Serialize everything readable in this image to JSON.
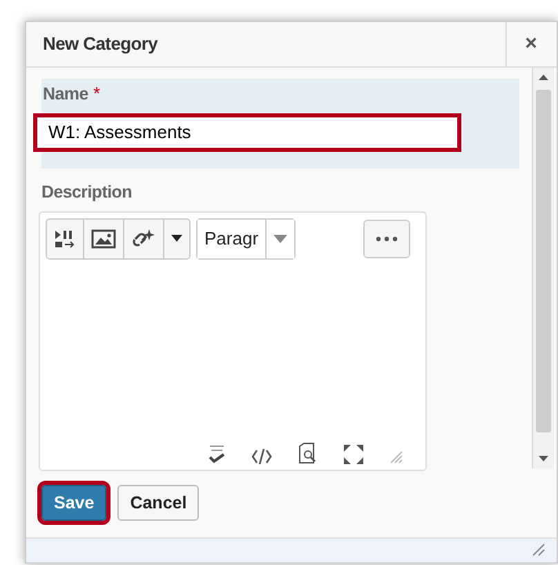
{
  "dialog": {
    "title": "New Category",
    "close": "×"
  },
  "name_field": {
    "label": "Name",
    "required_mark": "*",
    "value": "W1: Assessments",
    "highlighted": true
  },
  "description": {
    "label": "Description",
    "format_select": "Paragr"
  },
  "buttons": [
    {
      "label": "Save",
      "kind": "primary",
      "highlighted": true
    },
    {
      "label": "Cancel",
      "kind": "secondary",
      "highlighted": false
    }
  ]
}
